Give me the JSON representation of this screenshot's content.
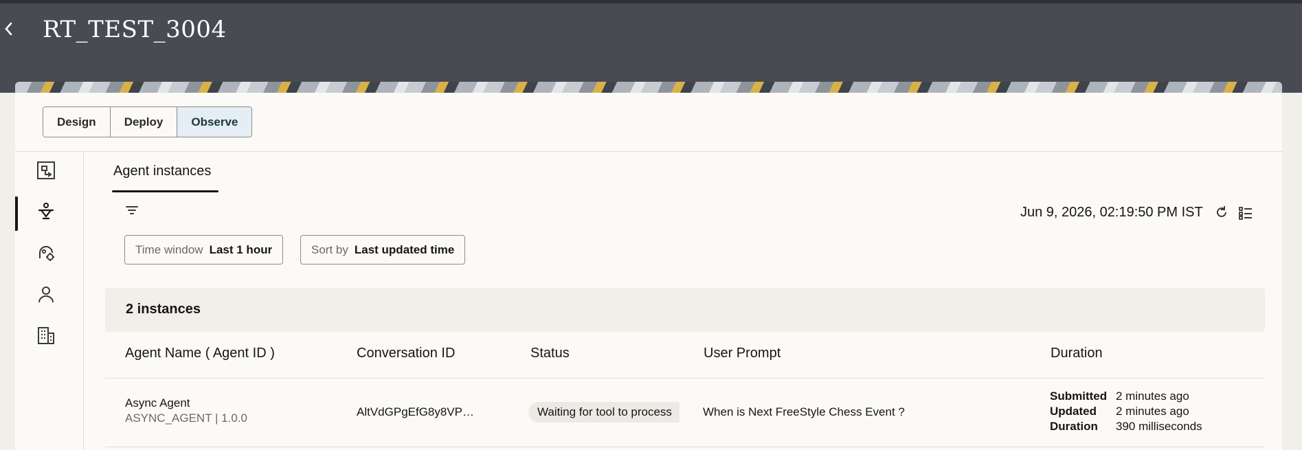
{
  "header": {
    "back_glyph": "‹",
    "title": "RT_TEST_3004"
  },
  "segments": [
    {
      "label": "Design",
      "active": false
    },
    {
      "label": "Deploy",
      "active": false
    },
    {
      "label": "Observe",
      "active": true
    }
  ],
  "rail": {
    "items": [
      {
        "icon": "flow-diagram-icon"
      },
      {
        "icon": "agent-instances-icon",
        "active": true
      },
      {
        "icon": "agent-settings-icon"
      },
      {
        "icon": "user-icon"
      },
      {
        "icon": "building-icon"
      }
    ]
  },
  "tabs": {
    "active_label": "Agent instances"
  },
  "toolbar": {
    "timestamp": "Jun 9, 2026, 02:19:50 PM IST",
    "filter_icon": "filter-icon",
    "refresh_icon": "refresh-icon",
    "columns_icon": "list-settings-icon"
  },
  "filters": {
    "time_window": {
      "label": "Time window",
      "value": "Last 1 hour"
    },
    "sort_by": {
      "label": "Sort by",
      "value": "Last updated time"
    }
  },
  "instances": {
    "count_label": "2 instances",
    "columns": [
      "Agent Name ( Agent ID )",
      "Conversation ID",
      "Status",
      "User Prompt",
      "Duration"
    ],
    "rows": [
      {
        "agent_name": "Async Agent",
        "agent_id": "ASYNC_AGENT | 1.0.0",
        "conversation_id": "AltVdGPgEfG8y8VP…",
        "status": "Waiting for tool to process",
        "user_prompt": "When is Next FreeStyle Chess Event ?",
        "duration": {
          "submitted_label": "Submitted",
          "submitted_value": "2 minutes ago",
          "updated_label": "Updated",
          "updated_value": "2 minutes ago",
          "duration_label": "Duration",
          "duration_value": "390 milliseconds"
        }
      }
    ]
  }
}
